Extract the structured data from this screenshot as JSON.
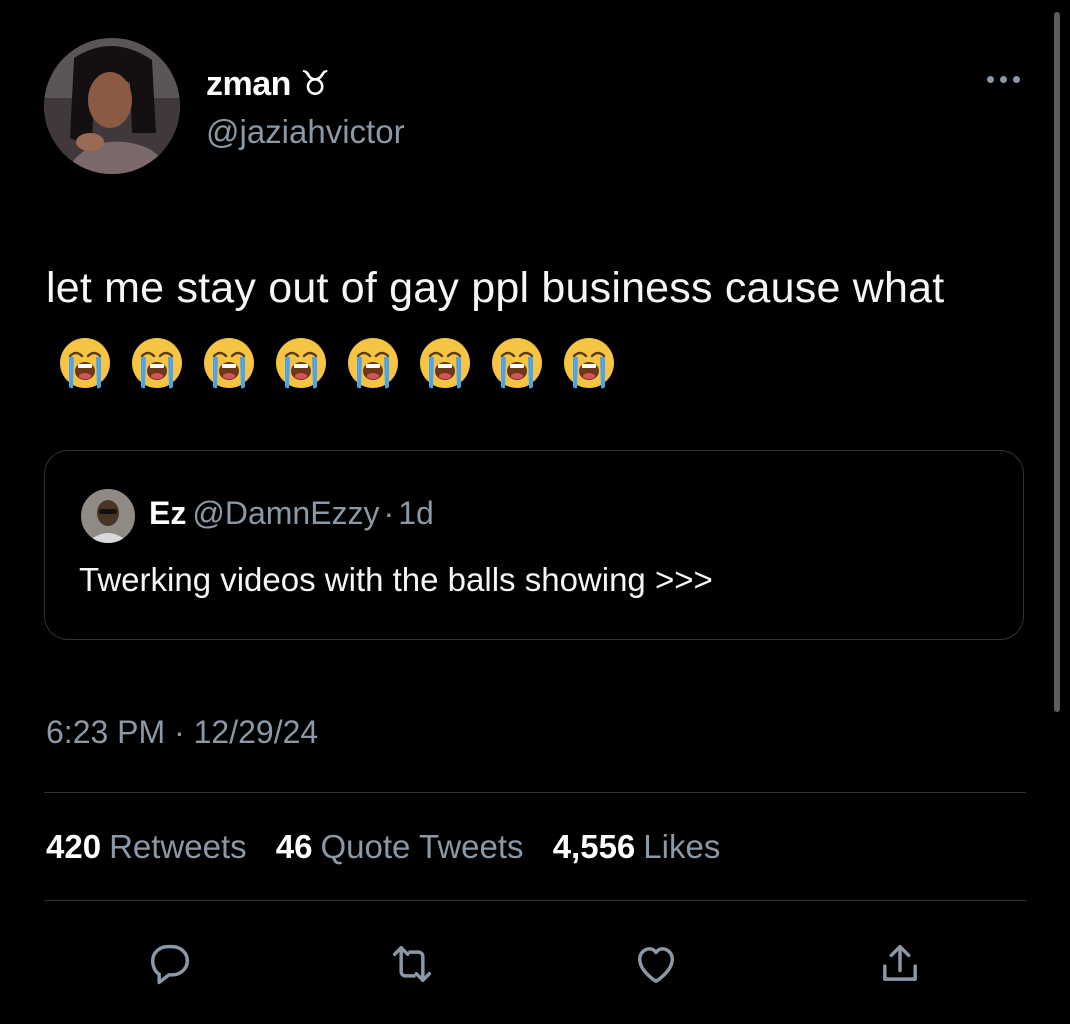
{
  "author": {
    "display_name": "zman ♉",
    "handle": "@jaziahvictor"
  },
  "tweet": {
    "text": "let me stay out of gay ppl business cause what",
    "emoji": [
      "loudly-crying-face",
      "loudly-crying-face",
      "loudly-crying-face",
      "loudly-crying-face",
      "loudly-crying-face",
      "loudly-crying-face",
      "loudly-crying-face",
      "loudly-crying-face"
    ]
  },
  "quoted": {
    "name": "Ez",
    "handle": "@DamnEzzy",
    "separator": "·",
    "time": "1d",
    "text": "Twerking videos with the balls showing >>>"
  },
  "timestamp": "6:23 PM · 12/29/24",
  "stats": {
    "retweets_count": "420",
    "retweets_label": "Retweets",
    "quotes_count": "46",
    "quotes_label": "Quote Tweets",
    "likes_count": "4,556",
    "likes_label": "Likes"
  },
  "actions": [
    "reply-icon",
    "retweet-icon",
    "like-icon",
    "share-icon"
  ],
  "colors": {
    "background": "#000000",
    "primary_text": "#e7e9ea",
    "secondary_text": "#8b98a5",
    "divider": "#2f3336"
  }
}
